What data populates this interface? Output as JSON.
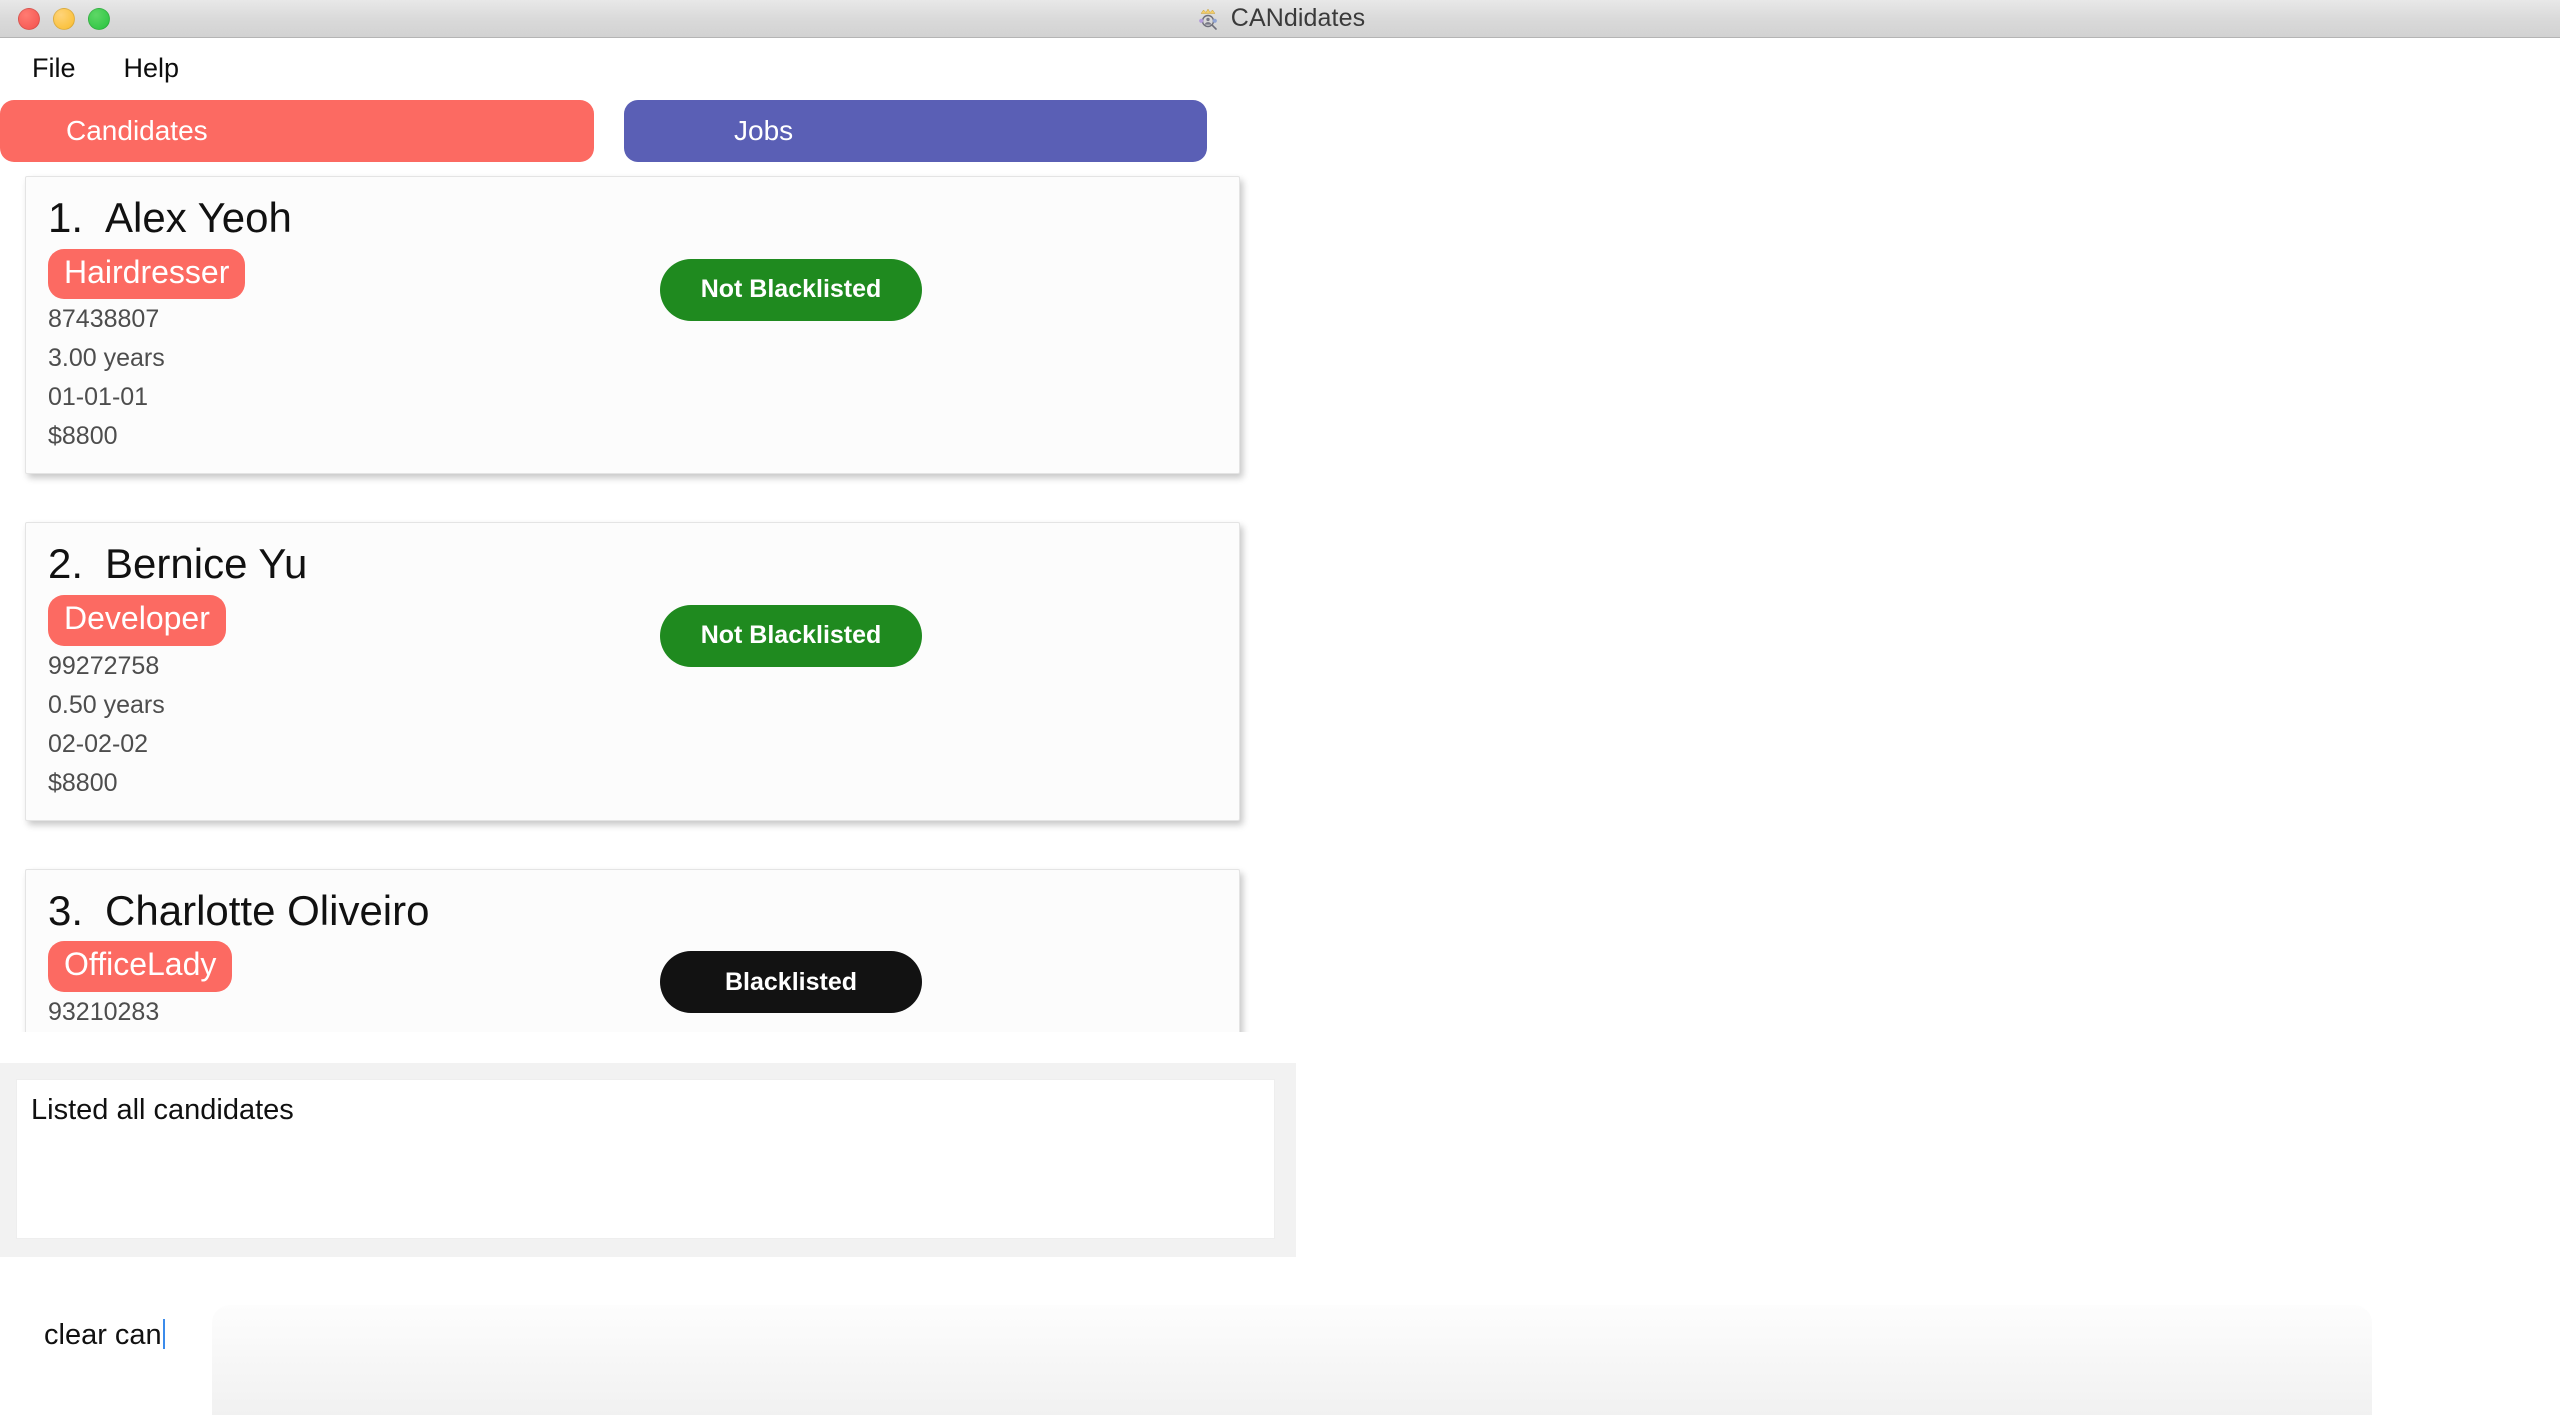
{
  "window": {
    "title": "CANdidates",
    "app_icon": "crown-people-icon",
    "traffic_lights": [
      {
        "name": "close",
        "color": "#f4524d"
      },
      {
        "name": "minimize",
        "color": "#f9bc2c"
      },
      {
        "name": "maximize",
        "color": "#28c33e"
      }
    ]
  },
  "menubar": {
    "items": [
      {
        "label": "File"
      },
      {
        "label": "Help"
      }
    ]
  },
  "tabs": [
    {
      "label": "Candidates",
      "color": "#fc6a62",
      "active": true
    },
    {
      "label": "Jobs",
      "color": "#5a5fb5",
      "active": false
    }
  ],
  "candidates": [
    {
      "index": "1.",
      "name": "Alex Yeoh",
      "role": "Hairdresser",
      "phone": "87438807",
      "experience": "3.00 years",
      "date": "01-01-01",
      "salary": "$8800",
      "blacklist_label": "Not Blacklisted",
      "blacklist_state": "ok",
      "blacklist_color": "#1f8a1f"
    },
    {
      "index": "2.",
      "name": "Bernice Yu",
      "role": "Developer",
      "phone": "99272758",
      "experience": "0.50 years",
      "date": "02-02-02",
      "salary": "$8800",
      "blacklist_label": "Not Blacklisted",
      "blacklist_state": "ok",
      "blacklist_color": "#1f8a1f"
    },
    {
      "index": "3.",
      "name": "Charlotte Oliveiro",
      "role": "OfficeLady",
      "phone": "93210283",
      "experience": "",
      "date": "",
      "salary": "",
      "blacklist_label": "Blacklisted",
      "blacklist_state": "bad",
      "blacklist_color": "#121212"
    }
  ],
  "result_panel": {
    "text": "Listed all candidates"
  },
  "command": {
    "value": "clear can",
    "placeholder": ""
  },
  "colors": {
    "accent_red": "#fc6a62",
    "accent_purple": "#5a5fb5",
    "status_ok": "#1f8a1f",
    "status_bad": "#121212"
  }
}
